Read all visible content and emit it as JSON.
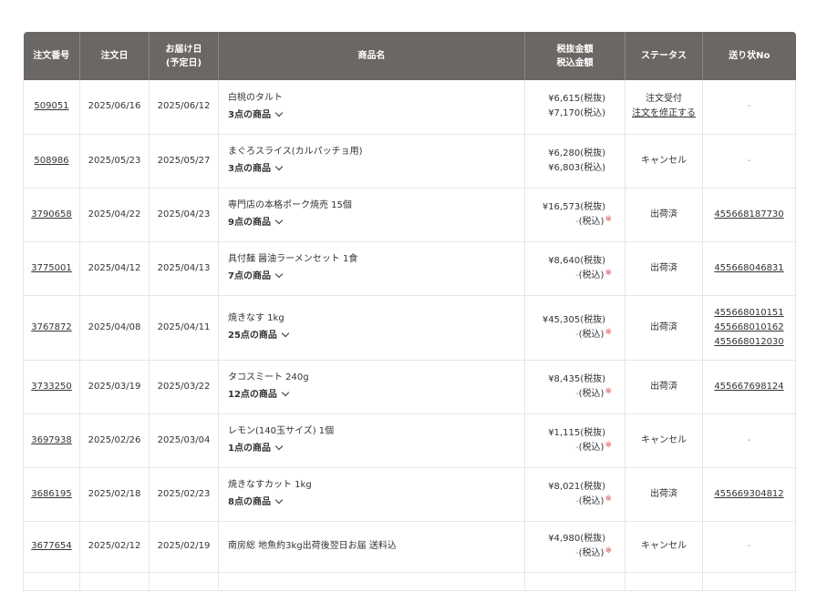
{
  "headers": {
    "order_no": "注文番号",
    "order_date": "注文日",
    "delivery_line1": "お届け日",
    "delivery_line2": "(予定日)",
    "product": "商品名",
    "amount_line1": "税抜金額",
    "amount_line2": "税込金額",
    "status": "ステータス",
    "tracking": "送り状No"
  },
  "labels": {
    "tax_excl": "(税抜)",
    "tax_incl": "(税込)",
    "modify_order": "注文を修正する",
    "star": "※"
  },
  "rows": [
    {
      "no": "509051",
      "date": "2025/06/16",
      "delivery": "2025/06/12",
      "product": "白桃のタルト",
      "count": "3点の商品",
      "excl": "¥6,615",
      "incl": "¥7,170",
      "incl_note": false,
      "status": "注文受付",
      "modify": true,
      "tracking": [
        "-"
      ]
    },
    {
      "no": "508986",
      "date": "2025/05/23",
      "delivery": "2025/05/27",
      "product": "まぐろスライス(カルパッチョ用)",
      "count": "3点の商品",
      "excl": "¥6,280",
      "incl": "¥6,803",
      "incl_note": false,
      "status": "キャンセル",
      "modify": false,
      "tracking": [
        "-"
      ]
    },
    {
      "no": "3790658",
      "date": "2025/04/22",
      "delivery": "2025/04/23",
      "product": "専門店の本格ポーク焼売 15個",
      "count": "9点の商品",
      "excl": "¥16,573",
      "incl": "-",
      "incl_note": true,
      "status": "出荷済",
      "modify": false,
      "tracking": [
        "455668187730"
      ]
    },
    {
      "no": "3775001",
      "date": "2025/04/12",
      "delivery": "2025/04/13",
      "product": "具付麺 醤油ラーメンセット 1食",
      "count": "7点の商品",
      "excl": "¥8,640",
      "incl": "-",
      "incl_note": true,
      "status": "出荷済",
      "modify": false,
      "tracking": [
        "455668046831"
      ]
    },
    {
      "no": "3767872",
      "date": "2025/04/08",
      "delivery": "2025/04/11",
      "product": "焼きなす 1kg",
      "count": "25点の商品",
      "excl": "¥45,305",
      "incl": "-",
      "incl_note": true,
      "status": "出荷済",
      "modify": false,
      "tracking": [
        "455668010151",
        "455668010162",
        "455668012030"
      ]
    },
    {
      "no": "3733250",
      "date": "2025/03/19",
      "delivery": "2025/03/22",
      "product": "タコスミート 240g",
      "count": "12点の商品",
      "excl": "¥8,435",
      "incl": "-",
      "incl_note": true,
      "status": "出荷済",
      "modify": false,
      "tracking": [
        "455667698124"
      ]
    },
    {
      "no": "3697938",
      "date": "2025/02/26",
      "delivery": "2025/03/04",
      "product": "レモン(140玉サイズ) 1個",
      "count": "1点の商品",
      "excl": "¥1,115",
      "incl": "-",
      "incl_note": true,
      "status": "キャンセル",
      "modify": false,
      "tracking": [
        "-"
      ]
    },
    {
      "no": "3686195",
      "date": "2025/02/18",
      "delivery": "2025/02/23",
      "product": "焼きなすカット 1kg",
      "count": "8点の商品",
      "excl": "¥8,021",
      "incl": "-",
      "incl_note": true,
      "status": "出荷済",
      "modify": false,
      "tracking": [
        "455669304812"
      ]
    },
    {
      "no": "3677654",
      "date": "2025/02/12",
      "delivery": "2025/02/19",
      "product": "南房総 地魚約3kg出荷後翌日お届 送料込",
      "count": "",
      "excl": "¥4,980",
      "incl": "-",
      "incl_note": true,
      "status": "キャンセル",
      "modify": false,
      "tracking": [
        "-"
      ]
    }
  ]
}
